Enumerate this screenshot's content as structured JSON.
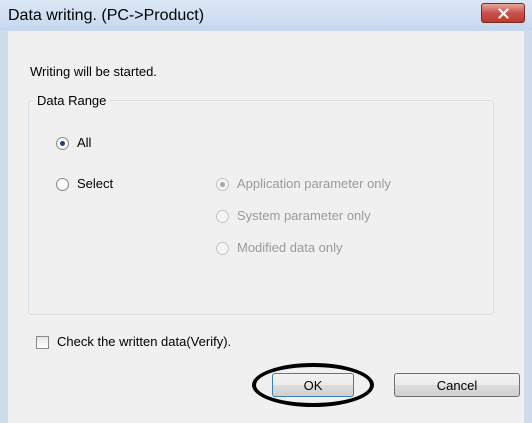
{
  "window": {
    "title": "Data writing. (PC->Product)"
  },
  "message": "Writing will be started.",
  "data_range": {
    "legend": "Data Range",
    "options": [
      {
        "label": "All",
        "checked": true,
        "enabled": true
      },
      {
        "label": "Select",
        "checked": false,
        "enabled": true
      }
    ],
    "sub_options": [
      {
        "label": "Application parameter only",
        "checked": true,
        "enabled": false
      },
      {
        "label": "System parameter only",
        "checked": false,
        "enabled": false
      },
      {
        "label": "Modified data only",
        "checked": false,
        "enabled": false
      }
    ]
  },
  "verify": {
    "label": "Check the written data(Verify).",
    "checked": false
  },
  "buttons": {
    "ok_label": "OK",
    "cancel_label": "Cancel"
  },
  "colors": {
    "titlebar": "#c6d7ee",
    "close_button": "#c75050",
    "client_background": "#f0f0f0",
    "disabled_text": "#9a9a9a",
    "highlight_ring": "#000000"
  },
  "icons": {
    "close": "close-icon"
  }
}
